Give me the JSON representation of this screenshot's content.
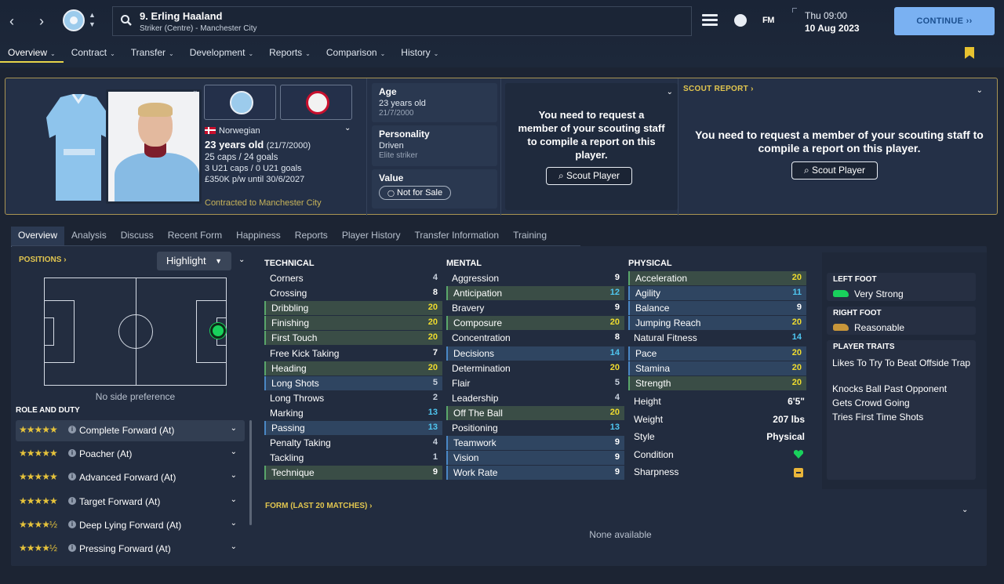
{
  "header": {
    "player_title": "9. Erling Haaland",
    "player_subtitle": "Striker (Centre) - Manchester City",
    "fm_label": "FM",
    "date_line1": "Thu 09:00",
    "date_line2": "10 Aug 2023",
    "continue_label": "CONTINUE"
  },
  "menu": [
    {
      "label": "Overview"
    },
    {
      "label": "Contract"
    },
    {
      "label": "Transfer"
    },
    {
      "label": "Development"
    },
    {
      "label": "Reports"
    },
    {
      "label": "Comparison"
    },
    {
      "label": "History"
    }
  ],
  "profile": {
    "nationality": "Norwegian",
    "age_main": "23 years old",
    "age_dob": "(21/7/2000)",
    "caps": "25 caps / 24 goals",
    "u21": "3 U21 caps / 0 U21 goals",
    "wage": "£350K p/w until 30/6/2027",
    "contracted": "Contracted to Manchester City",
    "age_label": "Age",
    "age_value": "23 years old",
    "age_sub": "21/7/2000",
    "personality_label": "Personality",
    "personality_value": "Driven",
    "personality_sub": "Elite striker",
    "value_label": "Value",
    "value_pill": "Not for Sale",
    "scout_msg": "You need to request a member of your scouting staff to compile a report on this player.",
    "scout_btn": "Scout Player",
    "scout_report_title": "SCOUT REPORT",
    "scout_report_msg": "You need to request a member of your scouting staff to compile a report on this player."
  },
  "subtabs": [
    {
      "label": "Overview"
    },
    {
      "label": "Analysis"
    },
    {
      "label": "Discuss"
    },
    {
      "label": "Recent Form"
    },
    {
      "label": "Happiness"
    },
    {
      "label": "Reports"
    },
    {
      "label": "Player History"
    },
    {
      "label": "Transfer Information"
    },
    {
      "label": "Training"
    }
  ],
  "positions": {
    "title": "POSITIONS",
    "highlight": "Highlight",
    "no_side": "No side preference",
    "role_title": "ROLE AND DUTY",
    "roles": [
      {
        "stars": "★★★★★",
        "label": "Complete Forward (At)"
      },
      {
        "stars": "★★★★★",
        "label": "Poacher (At)"
      },
      {
        "stars": "★★★★★",
        "label": "Advanced Forward (At)"
      },
      {
        "stars": "★★★★★",
        "label": "Target Forward (At)"
      },
      {
        "stars": "★★★★½",
        "label": "Deep Lying Forward (At)"
      },
      {
        "stars": "★★★★½",
        "label": "Pressing Forward (At)"
      }
    ]
  },
  "attributes": {
    "technical_title": "TECHNICAL",
    "mental_title": "MENTAL",
    "physical_title": "PHYSICAL",
    "technical": [
      [
        "Corners",
        "4"
      ],
      [
        "Crossing",
        "8"
      ],
      [
        "Dribbling",
        "20"
      ],
      [
        "Finishing",
        "20"
      ],
      [
        "First Touch",
        "20"
      ],
      [
        "Free Kick Taking",
        "7"
      ],
      [
        "Heading",
        "20"
      ],
      [
        "Long Shots",
        "5"
      ],
      [
        "Long Throws",
        "2"
      ],
      [
        "Marking",
        "13"
      ],
      [
        "Passing",
        "13"
      ],
      [
        "Penalty Taking",
        "4"
      ],
      [
        "Tackling",
        "1"
      ],
      [
        "Technique",
        "9"
      ]
    ],
    "mental": [
      [
        "Aggression",
        "9"
      ],
      [
        "Anticipation",
        "12"
      ],
      [
        "Bravery",
        "9"
      ],
      [
        "Composure",
        "20"
      ],
      [
        "Concentration",
        "8"
      ],
      [
        "Decisions",
        "14"
      ],
      [
        "Determination",
        "20"
      ],
      [
        "Flair",
        "5"
      ],
      [
        "Leadership",
        "4"
      ],
      [
        "Off The Ball",
        "20"
      ],
      [
        "Positioning",
        "13"
      ],
      [
        "Teamwork",
        "9"
      ],
      [
        "Vision",
        "9"
      ],
      [
        "Work Rate",
        "9"
      ]
    ],
    "physical": [
      [
        "Acceleration",
        "20"
      ],
      [
        "Agility",
        "11"
      ],
      [
        "Balance",
        "9"
      ],
      [
        "Jumping Reach",
        "20"
      ],
      [
        "Natural Fitness",
        "14"
      ],
      [
        "Pace",
        "20"
      ],
      [
        "Stamina",
        "20"
      ],
      [
        "Strength",
        "20"
      ]
    ],
    "details": [
      [
        "Height",
        "6'5\""
      ],
      [
        "Weight",
        "207 lbs"
      ],
      [
        "Style",
        "Physical"
      ],
      [
        "Condition",
        ""
      ],
      [
        "Sharpness",
        ""
      ]
    ]
  },
  "feet": {
    "left_title": "LEFT FOOT",
    "left_value": "Very Strong",
    "right_title": "RIGHT FOOT",
    "right_value": "Reasonable",
    "traits_title": "PLAYER TRAITS",
    "traits": [
      "Likes To Try To Beat Offside Trap",
      "Knocks Ball Past Opponent",
      "Gets Crowd Going",
      "Tries First Time Shots"
    ]
  },
  "form": {
    "title": "FORM (LAST 20 MATCHES)",
    "none": "None available"
  },
  "colors": {
    "accent_gold": "#e2c64f",
    "value_yellow": "#f0dc2e",
    "value_cyan": "#4fc6f0",
    "continue_blue": "#7ab1f2",
    "green_dot": "#19d15c"
  }
}
